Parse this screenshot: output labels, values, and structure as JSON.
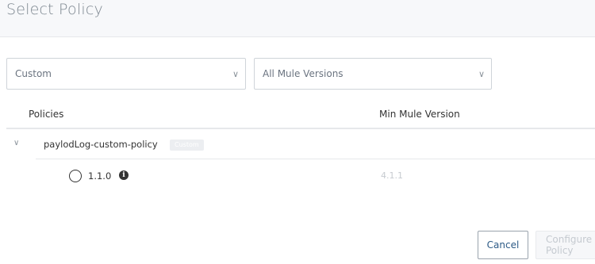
{
  "dialog": {
    "title": "Select Policy"
  },
  "filters": {
    "type_select": {
      "value": "Custom",
      "chevron_icon": "chevron-down-icon"
    },
    "version_select": {
      "value": "All Mule Versions",
      "chevron_icon": "chevron-down-icon"
    }
  },
  "table": {
    "headers": {
      "policies": "Policies",
      "min_version": "Min Mule Version"
    },
    "policy": {
      "name": "paylodLog-custom-policy",
      "badge": "Custom",
      "expanded_icon": "chevron-down-icon",
      "versions": [
        {
          "version": "1.1.0",
          "min_mule_version": "4.1.1",
          "selected": false,
          "info_icon": "info-icon"
        }
      ]
    }
  },
  "footer": {
    "cancel_label": "Cancel",
    "configure_label": "Configure Policy"
  },
  "colors": {
    "header_bg": "#f7f8fa",
    "link_blue": "#2c5a86",
    "disabled_text": "#c5cad0"
  }
}
